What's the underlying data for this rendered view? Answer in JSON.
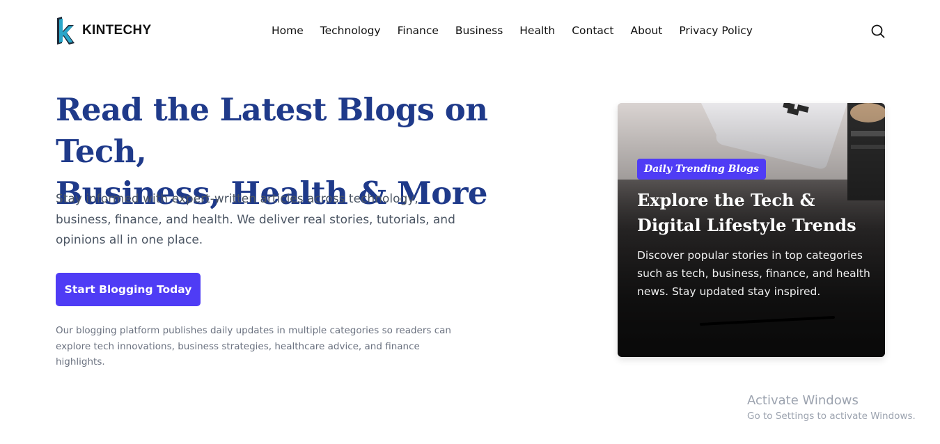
{
  "brand": {
    "name": "KINTECHY",
    "logo_icon": "k-letter-logo-icon",
    "logo_color": "#2aa6c9"
  },
  "nav": {
    "items": [
      "Home",
      "Technology",
      "Finance",
      "Business",
      "Health",
      "Contact",
      "About",
      "Privacy Policy"
    ],
    "search_icon": "search-icon"
  },
  "hero": {
    "title_line1": "Read the Latest Blogs on Tech,",
    "title_line2": "Business, Health & More",
    "subtitle": "Stay informed with expert-written articles across technology, business, finance, and health. We deliver real stories, tutorials, and opinions all in one place.",
    "cta_label": "Start Blogging Today",
    "note": "Our blogging platform publishes daily updates in multiple categories so readers can explore tech innovations, business strategies, healthcare advice, and finance highlights."
  },
  "card": {
    "badge": "Daily Trending Blogs",
    "title": "Explore the Tech & Digital Lifestyle Trends",
    "description": "Discover popular stories in top categories such as tech, business, finance, and health news. Stay updated stay inspired."
  },
  "windows_watermark": {
    "title": "Activate Windows",
    "subtitle": "Go to Settings to activate Windows."
  },
  "colors": {
    "primary": "#4f3cf5",
    "heading": "#1f3a8a",
    "body_text": "#4b5563",
    "muted_text": "#6b7280"
  }
}
